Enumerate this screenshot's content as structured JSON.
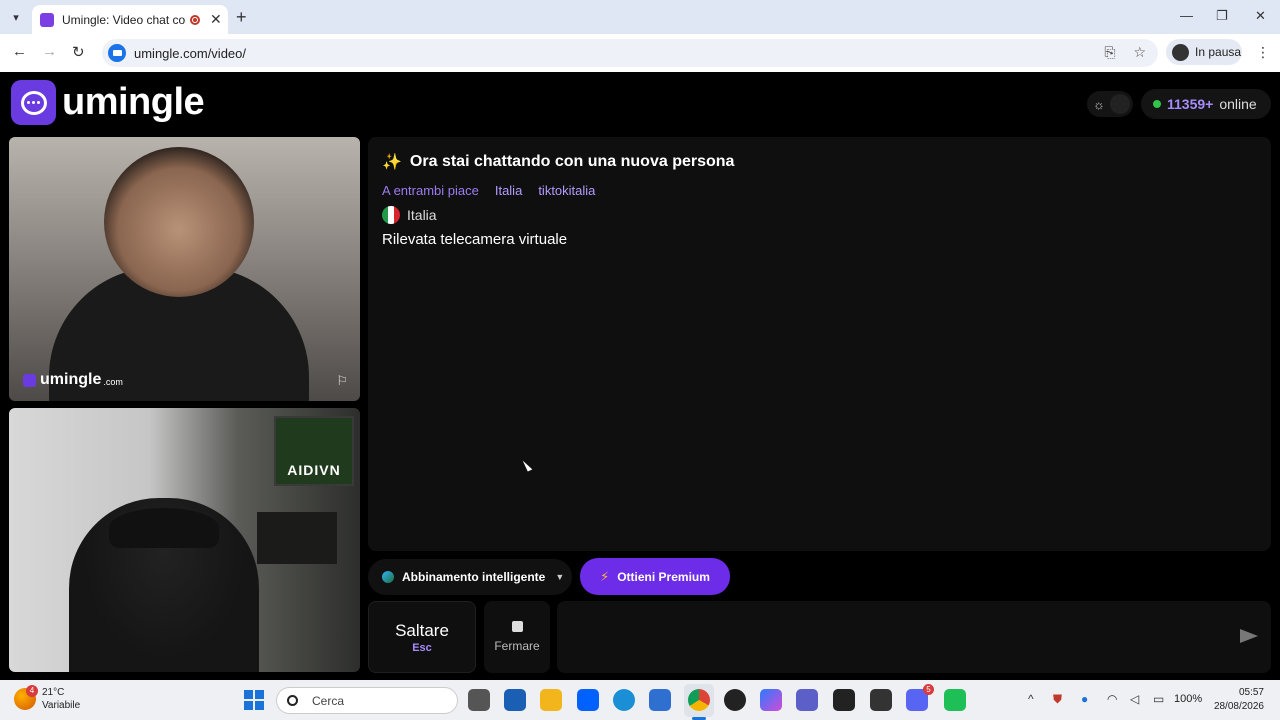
{
  "browser": {
    "tab_title": "Umingle: Video chat con sc",
    "url": "umingle.com/video/",
    "profile_label": "In pausa"
  },
  "header": {
    "logo_text": "umingle",
    "online_count": "11359+",
    "online_label": "online"
  },
  "video": {
    "watermark_brand": "umingle",
    "watermark_domain": ".com",
    "local_sign_text": "AIDIVN"
  },
  "chat": {
    "header_text": "Ora stai chattando con una nuova persona",
    "interests_label": "A entrambi piace",
    "tags": [
      "Italia",
      "tiktokitalia"
    ],
    "country": "Italia",
    "notice": "Rilevata telecamera virtuale"
  },
  "controls": {
    "match_label": "Abbinamento intelligente",
    "premium_label": "Ottieni Premium",
    "skip_label": "Saltare",
    "skip_key": "Esc",
    "stop_label": "Fermare",
    "message_placeholder": ""
  },
  "taskbar": {
    "weather_badge": "4",
    "temperature": "21°C",
    "weather_desc": "Variabile",
    "search_placeholder": "Cerca",
    "discord_badge": "5",
    "battery": "100%",
    "time": "05:57",
    "date": "28/08/2026"
  },
  "colors": {
    "brand": "#6a3be0",
    "premium": "#6d2ce8",
    "accent_text": "#a78bfa",
    "online_dot": "#31c44a"
  }
}
